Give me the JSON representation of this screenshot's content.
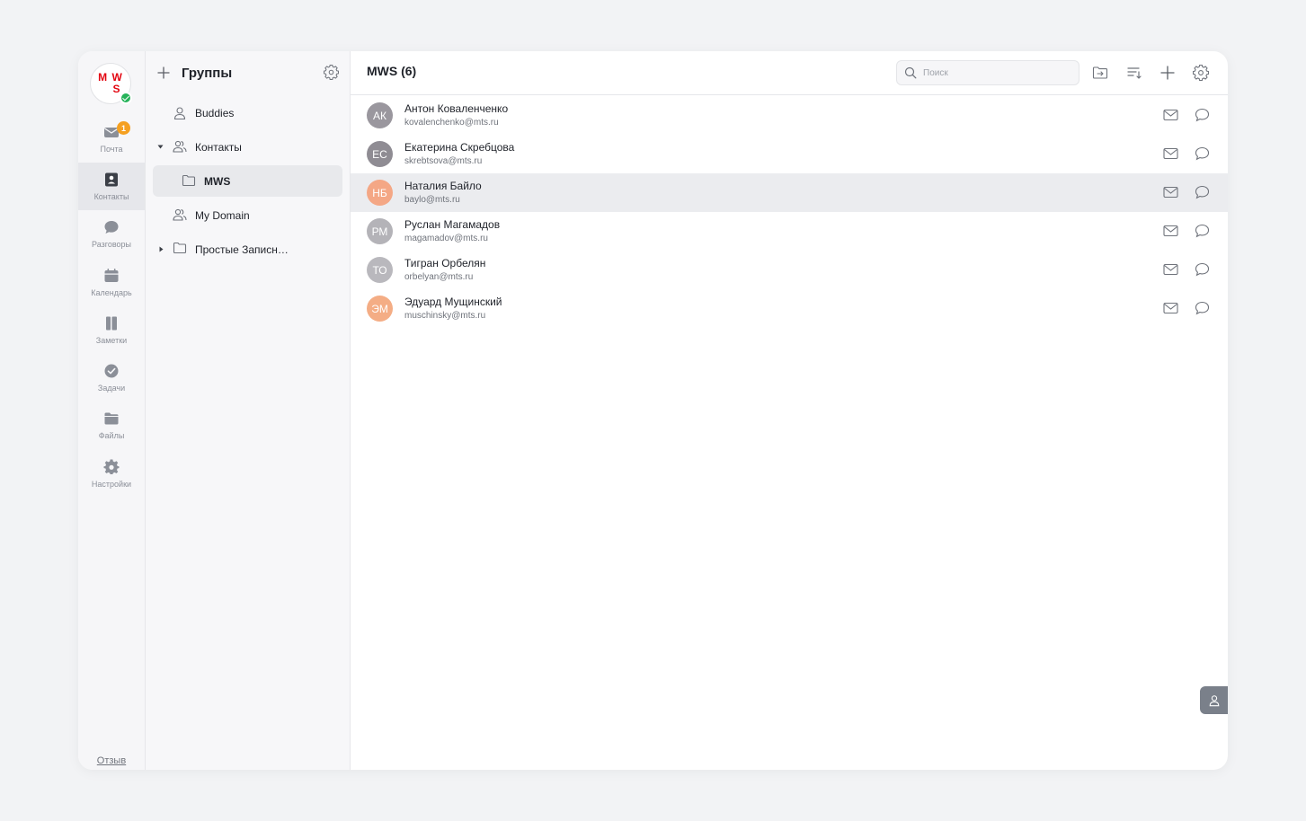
{
  "logo": {
    "text": "M W S"
  },
  "nav": {
    "items": [
      {
        "label": "Почта",
        "icon": "mail-icon",
        "badge": "1"
      },
      {
        "label": "Контакты",
        "icon": "contacts-icon"
      },
      {
        "label": "Разговоры",
        "icon": "chat-icon"
      },
      {
        "label": "Календарь",
        "icon": "calendar-icon"
      },
      {
        "label": "Заметки",
        "icon": "notes-icon"
      },
      {
        "label": "Задачи",
        "icon": "tasks-icon"
      },
      {
        "label": "Файлы",
        "icon": "files-icon"
      },
      {
        "label": "Настройки",
        "icon": "settings-icon"
      }
    ],
    "active": "Контакты",
    "feedback_label": "Отзыв"
  },
  "groups": {
    "title": "Группы",
    "items": [
      {
        "label": "Buddies",
        "icon": "person-icon"
      },
      {
        "label": "Контакты",
        "icon": "people-icon",
        "expanded": true
      },
      {
        "label": "MWS",
        "icon": "folder-icon",
        "active": true
      },
      {
        "label": "My Domain",
        "icon": "people-icon"
      },
      {
        "label": "Простые Записн…",
        "icon": "folder-icon",
        "expanded": false
      }
    ]
  },
  "main": {
    "title": "MWS (6)",
    "search": {
      "placeholder": "Поиск",
      "value": ""
    },
    "contacts": [
      {
        "initials": "АК",
        "name": "Антон Коваленченко",
        "email": "kovalenchenko@mts.ru",
        "color": "#9a979e"
      },
      {
        "initials": "ЕС",
        "name": "Екатерина Скребцова",
        "email": "skrebtsova@mts.ru",
        "color": "#8f8c93"
      },
      {
        "initials": "НБ",
        "name": "Наталия Байло",
        "email": "baylo@mts.ru",
        "color": "#f4a785",
        "selected": true
      },
      {
        "initials": "РМ",
        "name": "Руслан Магамадов",
        "email": "magamadov@mts.ru",
        "color": "#b4b3b8"
      },
      {
        "initials": "ТО",
        "name": "Тигран Орбелян",
        "email": "orbelyan@mts.ru",
        "color": "#b9b8bd"
      },
      {
        "initials": "ЭМ",
        "name": "Эдуард Мущинский",
        "email": "muschinsky@mts.ru",
        "color": "#f4ad85"
      }
    ]
  },
  "colors": {
    "brand": "#e30611",
    "badge": "#f5a020",
    "online": "#26b35a"
  }
}
